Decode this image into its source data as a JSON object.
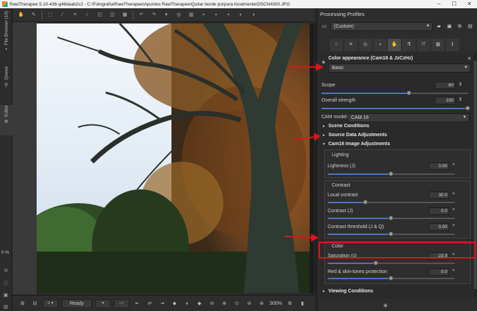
{
  "window": {
    "title": "RawTherapee 5.10-436-g46daab2c2 - C:\\Fotografía\\RawTherapee\\Apuntes RawTherapee\\Quitar borde púrpura localmente\\DSCN4300.JPG",
    "minimize": "–",
    "maximize": "☐",
    "close": "✕"
  },
  "left_tabs": {
    "file_browser": "File Browser (10)",
    "queue": "Queue",
    "editor": "Editor",
    "percent": "0 %"
  },
  "status": {
    "ready": "Ready",
    "zoom": "300%"
  },
  "profiles": {
    "title": "Processing Profiles",
    "selected": "(Custom)"
  },
  "color_appearance": {
    "title": "Color appearance (Cam16 & JzCzHz)",
    "mode": "Basic",
    "scope_label": "Scope",
    "scope_value": "60",
    "overall_strength_label": "Overall strength",
    "overall_strength_value": "100",
    "cam_model_label": "CAM model:",
    "cam_model_value": "CAM 16",
    "scene_conditions": "Scene Conditions",
    "source_data": "Source Data Adjustments",
    "cam16_image": "Cam16 Image Adjustments",
    "lighting": "Lighting",
    "lightness_label": "Lightness (J)",
    "lightness_value": "0.00",
    "contrast_header": "Contrast",
    "local_contrast_label": "Local contrast",
    "local_contrast_value": "30.0",
    "contrast_j_label": "Contrast (J)",
    "contrast_j_value": "0.0",
    "contrast_threshold_label": "Contrast threshold (J & Q)",
    "contrast_threshold_value": "0.00",
    "color_header": "Color",
    "saturation_label": "Saturation (s)",
    "saturation_value": "-23.9",
    "red_skin_label": "Red & skin-tones protection",
    "red_skin_value": "0.0",
    "viewing_conditions": "Viewing Conditions"
  },
  "sliders": {
    "scope": 0.6,
    "overall_strength": 1.0,
    "lightness": 0.5,
    "local_contrast": 0.3,
    "contrast_j": 0.5,
    "contrast_threshold": 0.5,
    "saturation": 0.38,
    "red_skin": 0.5
  },
  "colors": {
    "accent": "#4a78c0",
    "annotation": "#e0141b"
  }
}
